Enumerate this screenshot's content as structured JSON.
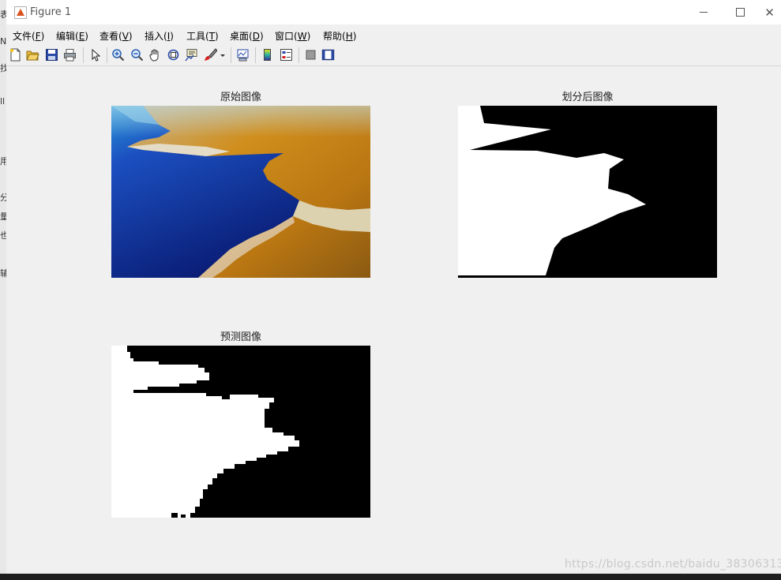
{
  "window": {
    "title": "Figure 1"
  },
  "menu": {
    "items": [
      {
        "label": "文件(",
        "key": "F",
        "tail": ")"
      },
      {
        "label": "编辑(",
        "key": "E",
        "tail": ")"
      },
      {
        "label": "查看(",
        "key": "V",
        "tail": ")"
      },
      {
        "label": "插入(",
        "key": "I",
        "tail": ")"
      },
      {
        "label": "工具(",
        "key": "T",
        "tail": ")"
      },
      {
        "label": "桌面(",
        "key": "D",
        "tail": ")"
      },
      {
        "label": "窗口(",
        "key": "W",
        "tail": ")"
      },
      {
        "label": "帮助(",
        "key": "H",
        "tail": ")"
      }
    ]
  },
  "toolbar": {
    "icons": [
      "new-figure-icon",
      "open-file-icon",
      "save-icon",
      "print-icon",
      "pointer-icon",
      "zoom-in-icon",
      "zoom-out-icon",
      "pan-hand-icon",
      "rotate-3d-icon",
      "data-cursor-icon",
      "brush-icon",
      "brush-dropdown-icon",
      "link-plot-icon",
      "colorbar-icon",
      "legend-icon",
      "hide-plot-tools-icon",
      "show-plot-tools-icon"
    ]
  },
  "figure": {
    "plots": [
      {
        "title": "原始图像",
        "kind": "photo"
      },
      {
        "title": "划分后图像",
        "kind": "mask-smooth"
      },
      {
        "title": "预测图像",
        "kind": "mask-blocky"
      }
    ]
  },
  "background_strip": {
    "chars": [
      "表",
      "N",
      "找",
      "ll",
      "",
      "用",
      "",
      "分",
      "量",
      "也",
      "",
      "辅"
    ]
  },
  "watermark": "https://blog.csdn.net/baidu_38306313",
  "colors": {
    "sea_dark": "#0a1a7a",
    "sea_light": "#1b5fd0",
    "land": "#c98a18",
    "town": "#d8c7a0"
  }
}
